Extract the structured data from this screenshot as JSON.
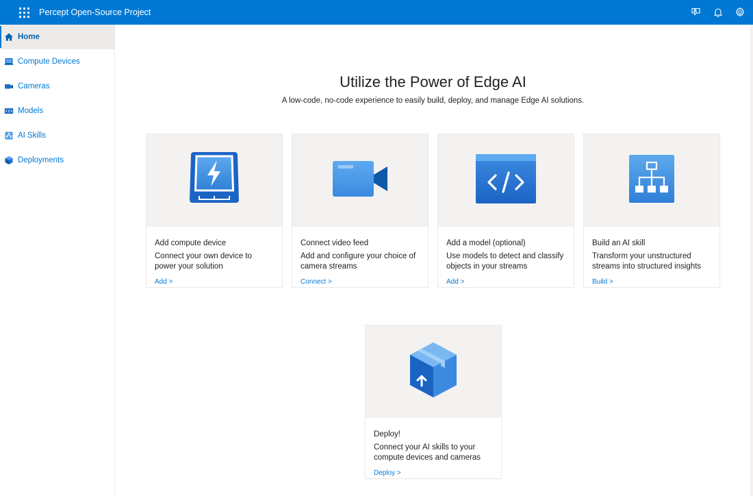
{
  "app": {
    "title": "Percept Open-Source Project"
  },
  "topbar": {
    "icons": [
      "waffle-icon",
      "feedback-icon",
      "bell-icon",
      "gear-icon"
    ]
  },
  "sidebar": {
    "items": [
      {
        "label": "Home",
        "icon": "home-icon",
        "active": true
      },
      {
        "label": "Compute Devices",
        "icon": "laptop-icon",
        "active": false
      },
      {
        "label": "Cameras",
        "icon": "camera-icon",
        "active": false
      },
      {
        "label": "Models",
        "icon": "model-icon",
        "active": false
      },
      {
        "label": "AI Skills",
        "icon": "ai-skill-icon",
        "active": false
      },
      {
        "label": "Deployments",
        "icon": "cube-icon",
        "active": false
      }
    ]
  },
  "hero": {
    "title": "Utilize the Power of Edge AI",
    "subtitle": "A low-code, no-code experience to easily build, deploy, and manage Edge AI solutions."
  },
  "cards": [
    {
      "title": "Add compute device",
      "description": "Connect your own device to power your solution",
      "link": "Add >",
      "icon": "compute-device-icon"
    },
    {
      "title": "Connect video feed",
      "description": "Add and configure your choice of camera streams",
      "link": "Connect >",
      "icon": "video-camera-icon"
    },
    {
      "title": "Add a model (optional)",
      "description": "Use models to detect and classify objects in your streams",
      "link": "Add >",
      "icon": "code-window-icon"
    },
    {
      "title": "Build an AI skill",
      "description": "Transform your unstructured streams into structured insights",
      "link": "Build >",
      "icon": "flowchart-icon"
    },
    {
      "title": "Deploy!",
      "description": "Connect your AI skills to your compute devices and cameras",
      "link": "Deploy >",
      "icon": "deploy-box-icon"
    }
  ],
  "colors": {
    "accent": "#0078d4",
    "nav_active_bg": "#edebe9",
    "card_media_bg": "#f3f2f1"
  }
}
